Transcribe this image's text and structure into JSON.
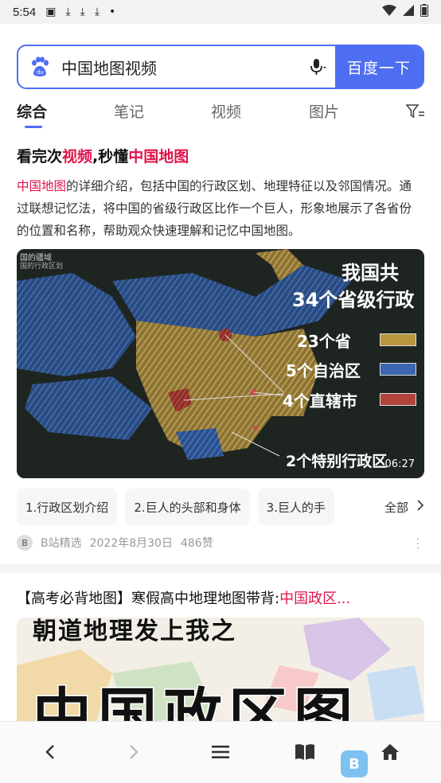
{
  "status_bar": {
    "time": "5:54"
  },
  "search": {
    "query": "中国地图视频",
    "button_label": "百度一下"
  },
  "tabs": [
    {
      "label": "综合",
      "active": true
    },
    {
      "label": "笔记",
      "active": false
    },
    {
      "label": "视频",
      "active": false
    },
    {
      "label": "图片",
      "active": false
    }
  ],
  "result1": {
    "title_parts": [
      "看完次",
      "视频",
      ",秒懂",
      "中国地图"
    ],
    "desc_highlight": "中国地图",
    "desc_rest": "的详细介绍，包括中国的行政区划、地理特征以及邻国情况。通过联想记忆法，将中国的省级行政区比作一个巨人，形象地展示了各省份的位置和名称，帮助观众快速理解和记忆中国地图。",
    "video": {
      "corner_text": "国的疆域",
      "corner_sub": "国的行政区划",
      "heading_line1": "我国共",
      "heading_line2": "34个省级行政",
      "legend": [
        {
          "label": "23个省",
          "color": "#b8963f"
        },
        {
          "label": "5个自治区",
          "color": "#3b66b0"
        },
        {
          "label": "4个直辖市",
          "color": "#b0443b"
        }
      ],
      "special": "2个特别行政区",
      "duration": "06:27"
    },
    "chips": [
      "1.行政区划介绍",
      "2.巨人的头部和身体",
      "3.巨人的手"
    ],
    "chips_all": "全部",
    "source": "B站精选",
    "date": "2022年8月30日",
    "likes": "486赞"
  },
  "result2": {
    "title_prefix": "【高考必背地图】寒假高中地理地图带背:",
    "title_highlight": "中国政区...",
    "thumb_top_text": "朝道地理发上我之",
    "thumb_big_text": "中国政区图"
  },
  "colors": {
    "accent": "#4e6ef2",
    "highlight": "#e0144c"
  },
  "icons": [
    "baidu-paw-icon",
    "mic-icon",
    "filter-icon",
    "back-icon",
    "forward-icon",
    "menu-icon",
    "book-icon",
    "home-icon"
  ]
}
